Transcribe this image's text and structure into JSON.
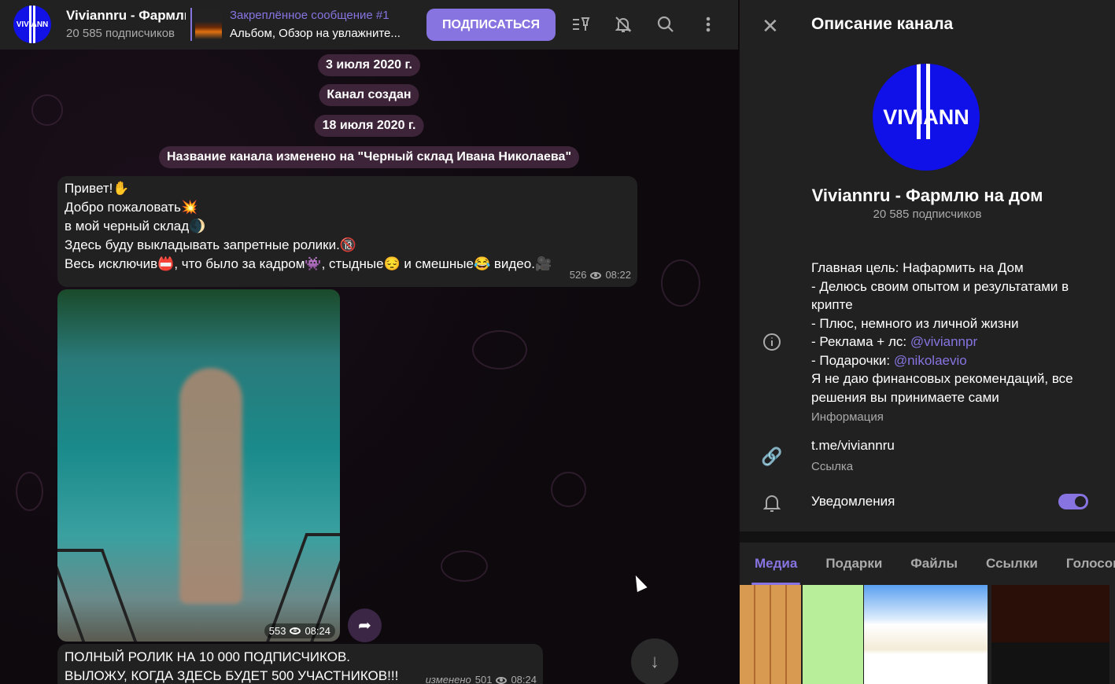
{
  "header": {
    "channel_name": "Viviannru - Фармлю на дом",
    "avatar_text": "VIVIANN",
    "subscribers": "20 585 подписчиков",
    "pinned_title": "Закреплённое сообщение #1",
    "pinned_text": "Альбом, Обзор на увлажните...",
    "subscribe_label": "ПОДПИСАТЬСЯ"
  },
  "service": [
    "3 июля 2020 г.",
    "Канал создан",
    "18 июля 2020 г.",
    "Название канала изменено на \"Черный склад Ивана Николаева\""
  ],
  "messages": [
    {
      "lines": [
        "Привет!✋",
        "Добро пожаловать💥",
        "в мой черный склад🌒",
        "Здесь буду выкладывать запретные ролики.🔞",
        "Весь исключив📛, что было за кадром👾, стыдные😔 и смешные😂 видео.🎥"
      ],
      "views": "526",
      "time": "08:22"
    },
    {
      "type": "video",
      "views": "553",
      "time": "08:24"
    },
    {
      "lines": [
        "ПОЛНЫЙ РОЛИК НА 10 000 ПОДПИСЧИКОВ.",
        "ВЫЛОЖУ, КОГДА ЗДЕСЬ БУДЕТ 500 УЧАСТНИКОВ!!!"
      ],
      "edited": "изменено",
      "views": "501",
      "time": "08:24"
    }
  ],
  "panel": {
    "title": "Описание канала",
    "avatar_text": "VIVIANN",
    "name": "Viviannru - Фармлю на дом",
    "subscribers": "20 585 подписчиков",
    "description": {
      "l1": "Главная цель: Нафармить на Дом",
      "l2": "- Делюсь своим опытом и результатами в крипте",
      "l3": "- Плюс, немного из личной жизни",
      "l4": "- Реклама + лс: ",
      "l4link": "@viviannpr",
      "l5": "- Подарочки: ",
      "l5link": "@nikolaevio",
      "l6": "Я не даю финансовых рекомендаций, все решения вы принимаете сами"
    },
    "info_label": "Информация",
    "link": "t.me/viviannru",
    "link_label": "Ссылка",
    "notifications_label": "Уведомления",
    "notifications_on": true,
    "tabs": [
      "Медиа",
      "Подарки",
      "Файлы",
      "Ссылки",
      "Голосовые"
    ]
  },
  "colors": {
    "accent": "#8774e1",
    "panel": "#212121",
    "avatar": "#1212e6"
  }
}
